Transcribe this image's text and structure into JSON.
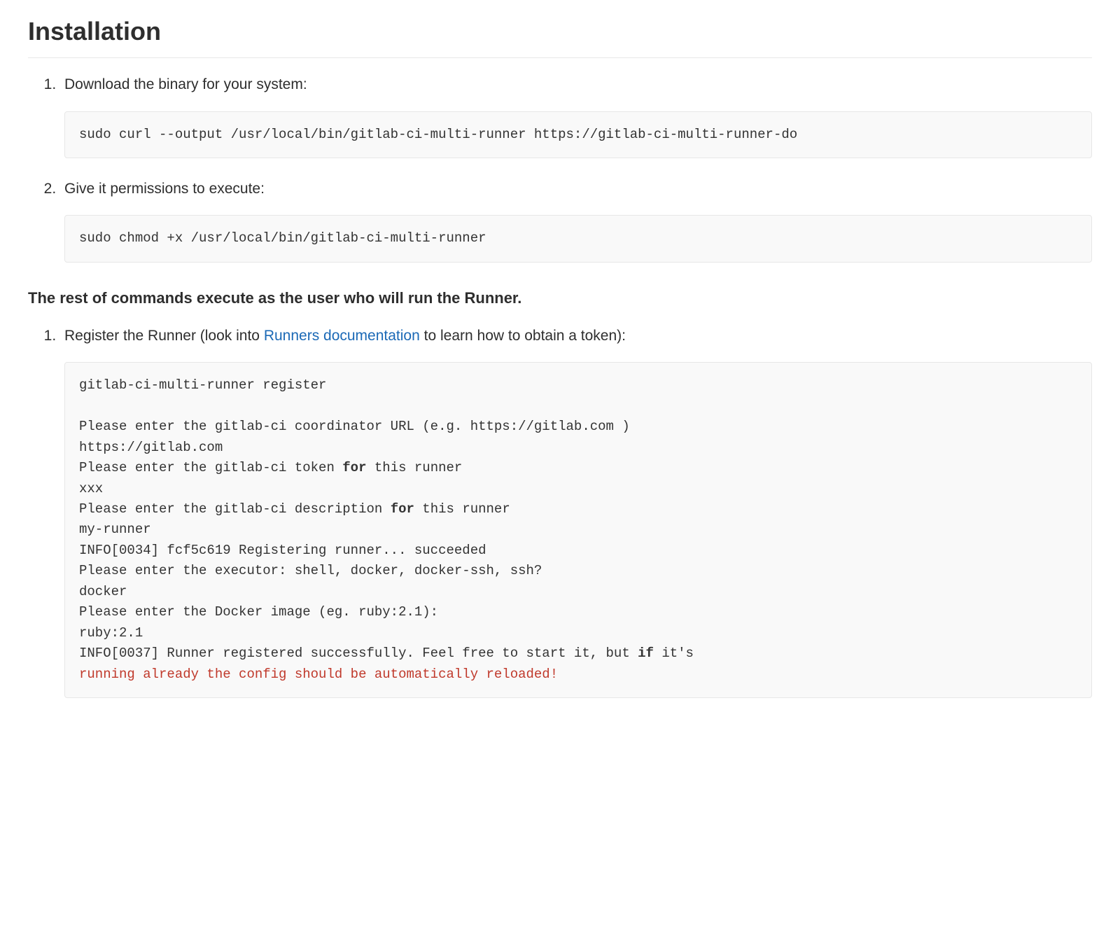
{
  "heading": "Installation",
  "list1": [
    {
      "text": "Download the binary for your system:",
      "code": "sudo curl --output /usr/local/bin/gitlab-ci-multi-runner https://gitlab-ci-multi-runner-do"
    },
    {
      "text": "Give it permissions to execute:",
      "code": "sudo chmod +x /usr/local/bin/gitlab-ci-multi-runner"
    }
  ],
  "note": "The rest of commands execute as the user who will run the Runner.",
  "list2": [
    {
      "text_before": "Register the Runner (look into ",
      "link_text": "Runners documentation",
      "text_after": " to learn how to obtain a token):",
      "code_lines": [
        {
          "t": "gitlab-ci-multi-runner register"
        },
        {
          "t": ""
        },
        {
          "t": "Please enter the gitlab-ci coordinator URL (e.g. https://gitlab.com )"
        },
        {
          "t": "https://gitlab.com"
        },
        {
          "pre": "Please enter the gitlab-ci token ",
          "kw": "for",
          "post": " this runner"
        },
        {
          "t": "xxx"
        },
        {
          "pre": "Please enter the gitlab-ci description ",
          "kw": "for",
          "post": " this runner"
        },
        {
          "t": "my-runner"
        },
        {
          "t": "INFO[0034] fcf5c619 Registering runner... succeeded"
        },
        {
          "t": "Please enter the executor: shell, docker, docker-ssh, ssh?"
        },
        {
          "t": "docker"
        },
        {
          "t": "Please enter the Docker image (eg. ruby:2.1):"
        },
        {
          "t": "ruby:2.1"
        },
        {
          "pre": "INFO[0037] Runner registered successfully. Feel free to start it, but ",
          "kw": "if",
          "post": " it's"
        },
        {
          "err": "running already the config should be automatically reloaded!"
        }
      ]
    }
  ]
}
